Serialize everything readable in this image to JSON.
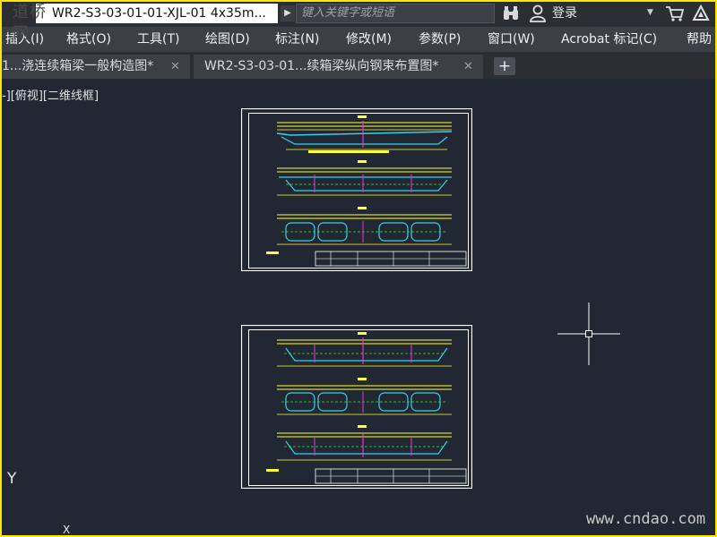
{
  "watermark": {
    "logo_text": "道桥网",
    "site": "www.cndao.com"
  },
  "titlebar": {
    "document_title": "WR2-S3-03-01-01-XJL-01 4x35m...",
    "search_placeholder": "键入关键字或短语",
    "login_label": "登录",
    "icons": [
      "binoculars-icon",
      "user-icon",
      "cart-icon",
      "a360-icon"
    ]
  },
  "menu": {
    "items": [
      "插入(I)",
      "格式(O)",
      "工具(T)",
      "绘图(D)",
      "标注(N)",
      "修改(M)",
      "参数(P)",
      "窗口(W)",
      "Acrobat 标记(C)",
      "帮助"
    ]
  },
  "tabs": [
    {
      "label": "1...浇连续箱梁一般构造图*",
      "close": "✕"
    },
    {
      "label": "WR2-S3-03-01...续箱梁纵向钢束布置图*",
      "close": "✕"
    }
  ],
  "tab_add": "+",
  "viewport": {
    "label": "-][俯视][二维线框]"
  },
  "ucs": {
    "y": "Y",
    "x": "X"
  },
  "colors": {
    "canvas": "#212833",
    "drawing_yellow": "#ffff33",
    "drawing_cyan": "#3ad0e8",
    "drawing_magenta": "#e03ad0",
    "drawing_green": "#36e13a",
    "frame_border": "#ffe600"
  }
}
